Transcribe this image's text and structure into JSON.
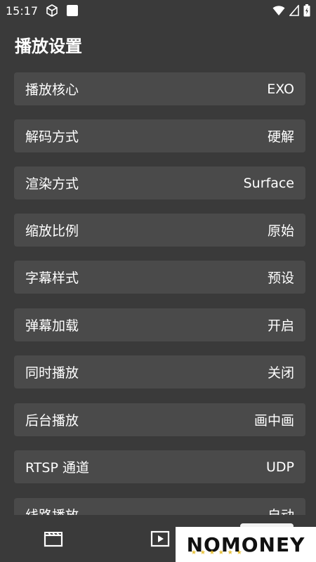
{
  "status_bar": {
    "time": "15:17",
    "icons": [
      "cube-icon",
      "square-icon",
      "wifi-icon",
      "signal-icon",
      "battery-icon"
    ]
  },
  "page": {
    "title": "播放设置"
  },
  "settings": [
    {
      "label": "播放核心",
      "value": "EXO"
    },
    {
      "label": "解码方式",
      "value": "硬解"
    },
    {
      "label": "渲染方式",
      "value": "Surface"
    },
    {
      "label": "缩放比例",
      "value": "原始"
    },
    {
      "label": "字幕样式",
      "value": "预设"
    },
    {
      "label": "弹幕加载",
      "value": "开启"
    },
    {
      "label": "同时播放",
      "value": "关闭"
    },
    {
      "label": "后台播放",
      "value": "画中画"
    },
    {
      "label": "RTSP 通道",
      "value": "UDP"
    },
    {
      "label": "线路播放",
      "value": "自动"
    }
  ],
  "bottom_nav": {
    "icons": [
      "film-icon",
      "play-icon"
    ]
  },
  "watermark": {
    "text": "NOMONEY"
  },
  "colors": {
    "background": "#3a3a3a",
    "row_background": "#4a4a4a",
    "text": "#ffffff"
  }
}
